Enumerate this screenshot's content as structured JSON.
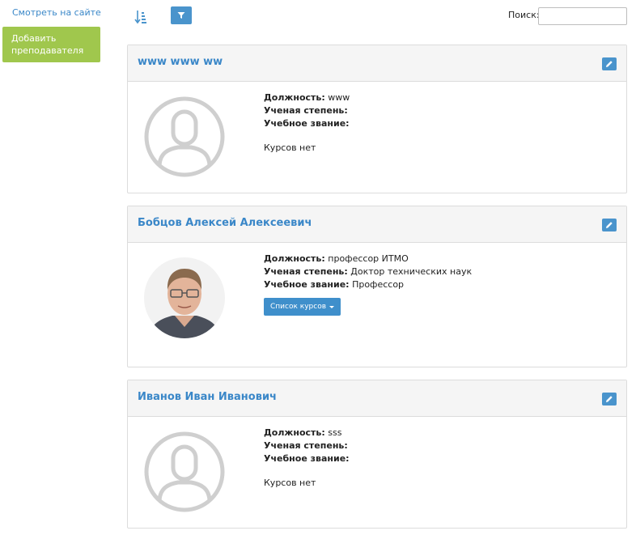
{
  "sidebar": {
    "view_on_site": "Смотреть на сайте",
    "add_teacher": "Добавить преподавателя"
  },
  "toolbar": {
    "sort_icon": "sort-amount-icon",
    "filter_icon": "filter-icon",
    "search_label": "Поиск:",
    "search_value": ""
  },
  "labels": {
    "position": "Должность:",
    "degree": "Ученая степень:",
    "title": "Учебное звание:",
    "no_courses": "Курсов нет",
    "courses_list": "Список курсов"
  },
  "teachers": [
    {
      "name": "www www ww",
      "position": "www",
      "degree": "",
      "title": "",
      "has_photo": false,
      "has_courses": false
    },
    {
      "name": "Бобцов Алексей Алексеевич",
      "position": "профессор ИТМО",
      "degree": "Доктор технических наук",
      "title": "Профессор",
      "has_photo": true,
      "has_courses": true
    },
    {
      "name": "Иванов Иван Иванович",
      "position": "sss",
      "degree": "",
      "title": "",
      "has_photo": false,
      "has_courses": false
    }
  ],
  "colors": {
    "accent": "#3a87c8",
    "button_blue": "#4a94cc",
    "add_button": "#a0c74d",
    "header_bg": "#f5f5f5",
    "avatar_placeholder": "#cfcfcf"
  }
}
